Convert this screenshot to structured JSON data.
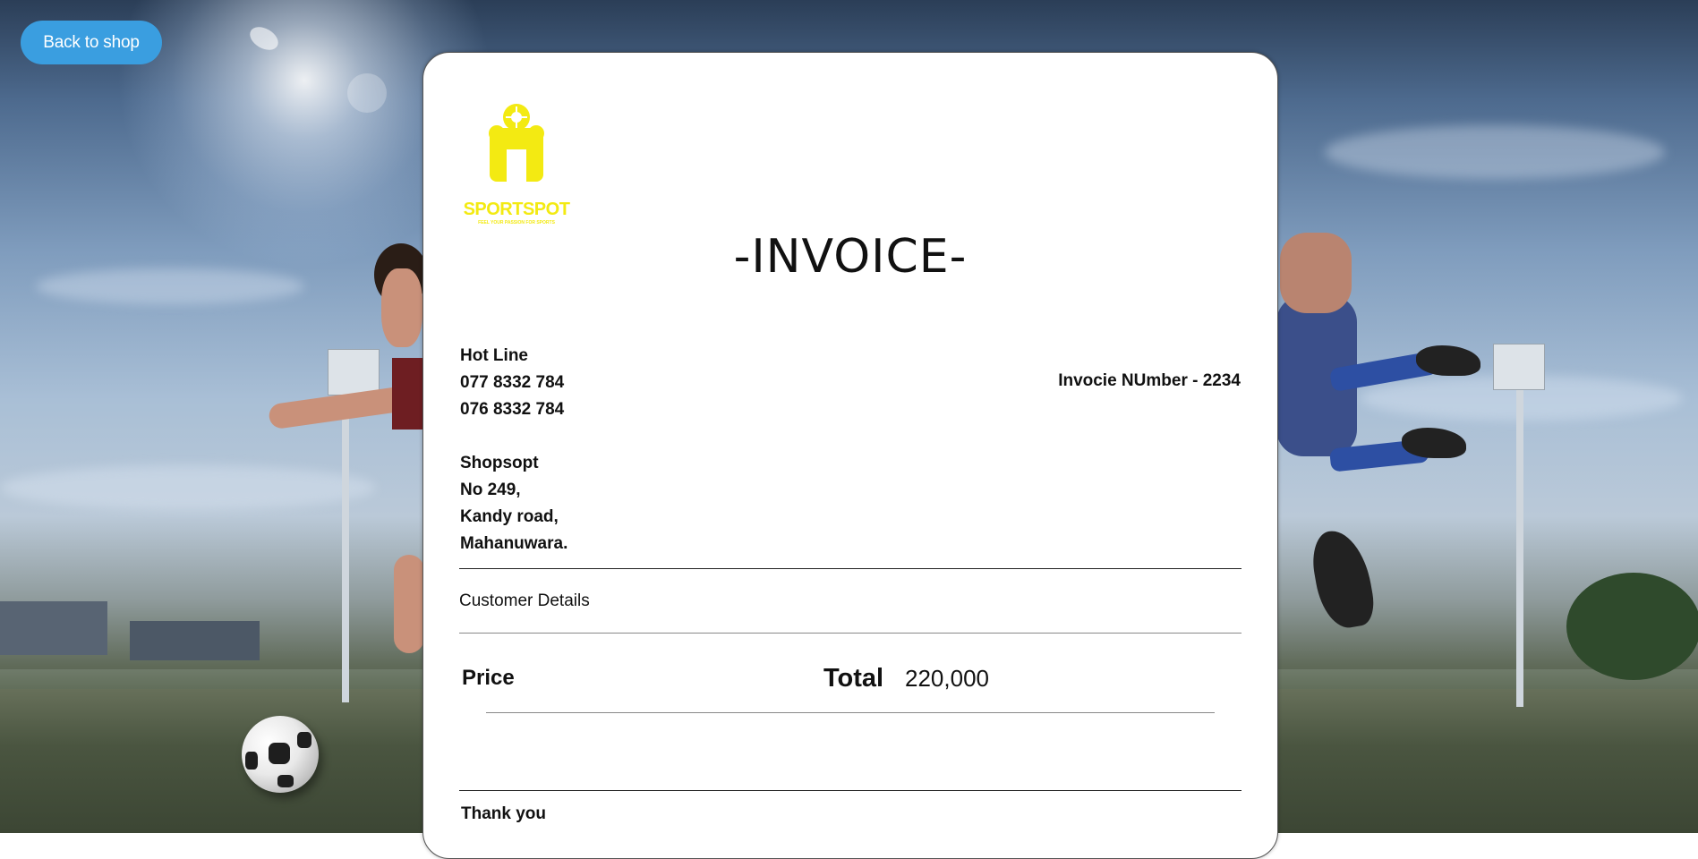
{
  "nav": {
    "back_label": "Back to shop"
  },
  "logo": {
    "brand": "SPORTSPOT",
    "tagline": "FEEL YOUR PASSION FOR SPORTS",
    "color": "#f3ea12"
  },
  "invoice": {
    "title": "-INVOICE-",
    "hotline_label": "Hot Line",
    "hotline_1": "077 8332 784",
    "hotline_2": "076 8332 784",
    "invoice_number": "Invocie NUmber - 2234",
    "shop_name": "Shopsopt",
    "address_1": "No 249,",
    "address_2": "Kandy road,",
    "address_3": "Mahanuwara.",
    "customer_details": "Customer Details",
    "price_label": "Price",
    "total_label": "Total",
    "total_value": "220,000",
    "thank_you": "Thank you"
  },
  "colors": {
    "button_bg": "#3a9ee0",
    "card_bg": "#ffffff"
  }
}
